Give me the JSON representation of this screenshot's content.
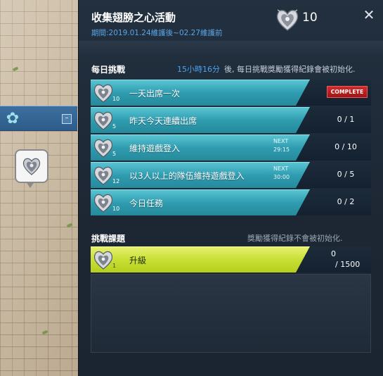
{
  "panel": {
    "title": "收集翅膀之心活動",
    "period": "期間:2019.01.24維護後~02.27維護前",
    "heart_count": "10",
    "close_icon": "close-icon"
  },
  "daily": {
    "title": "每日挑戰",
    "timer": "15小時16分",
    "reset_note": "後, 每日挑戰獎勵獲得紀錄會被初始化.",
    "rows": [
      {
        "label": "一天出席一次",
        "level": "10",
        "complete": "COMPLETE",
        "progress": ""
      },
      {
        "label": "昨天今天連續出席",
        "level": "5",
        "progress": "0 / 1"
      },
      {
        "label": "維持遊戲登入",
        "level": "5",
        "next": "NEXT",
        "next_time": "29:15",
        "progress": "0 / 10"
      },
      {
        "label": "以3人以上的隊伍維持遊戲登入",
        "level": "12",
        "next": "NEXT",
        "next_time": "30:00",
        "progress": "0 / 5"
      },
      {
        "label": "今日任務",
        "level": "10",
        "progress": "0 / 2"
      }
    ]
  },
  "tasks": {
    "title": "挑戰課題",
    "note": "獎勵獲得紀錄不會被初始化.",
    "rows": [
      {
        "label": "升級",
        "level": "1",
        "progress_top": "0",
        "progress_bottom": "/ 1500"
      }
    ]
  },
  "colors": {
    "daily_row": "#2f9cb0",
    "task_row": "#c8df33",
    "complete_badge": "#b81d1d",
    "timer": "#4aa3ee"
  }
}
